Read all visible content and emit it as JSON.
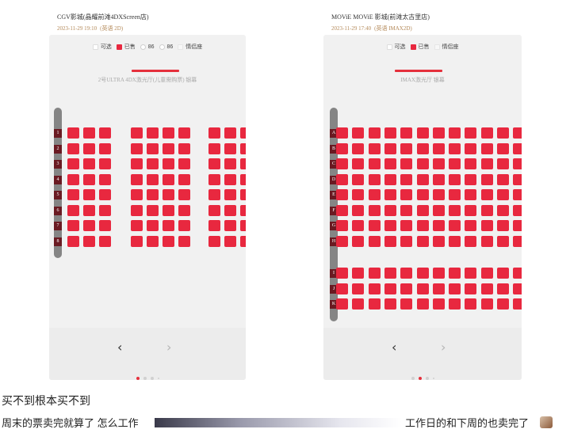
{
  "left": {
    "cinema_name": "CGV影城(晶耀前滩4DXScreen店)",
    "show_date": "2023-11-29 19:10",
    "show_format": "(英语 2D)",
    "legend": [
      {
        "label": "可选",
        "swatch": "avail"
      },
      {
        "label": "已售",
        "swatch": "sold"
      },
      {
        "label": "86",
        "swatch": "circle"
      },
      {
        "label": "86",
        "swatch": "circle"
      },
      {
        "label": "情侣座",
        "swatch": "faint"
      }
    ],
    "screen_label": "2号ULTRA 4DX激光厅(儿童需购票) 银幕",
    "rows": [
      "1",
      "2",
      "3",
      "4",
      "5",
      "6",
      "7",
      "8"
    ],
    "nav": {
      "prev": "‹",
      "next": "›"
    }
  },
  "right": {
    "cinema_name": "MOViE MOViE 影城(前滩太古里店)",
    "show_date": "2023-11-29 17:40",
    "show_format": "(英语 IMAX2D)",
    "legend": [
      {
        "label": "可选",
        "swatch": "avail"
      },
      {
        "label": "已售",
        "swatch": "sold"
      },
      {
        "label": "情侣座",
        "swatch": "faint"
      }
    ],
    "screen_label": "IMAX激光厅 银幕",
    "rows": [
      "A",
      "B",
      "C",
      "D",
      "E",
      "F",
      "G",
      "H",
      "I",
      "J",
      "K"
    ],
    "nav": {
      "prev": "‹",
      "next": "›"
    }
  },
  "captions": {
    "line1": "买不到根本买不到",
    "line2": "周末的票卖完就算了 怎么工作",
    "line2_end": "工作日的和下周的也卖完了"
  },
  "colors": {
    "sold": "#e8283f",
    "accent": "#e5303c",
    "showtime": "#b48a5a"
  }
}
